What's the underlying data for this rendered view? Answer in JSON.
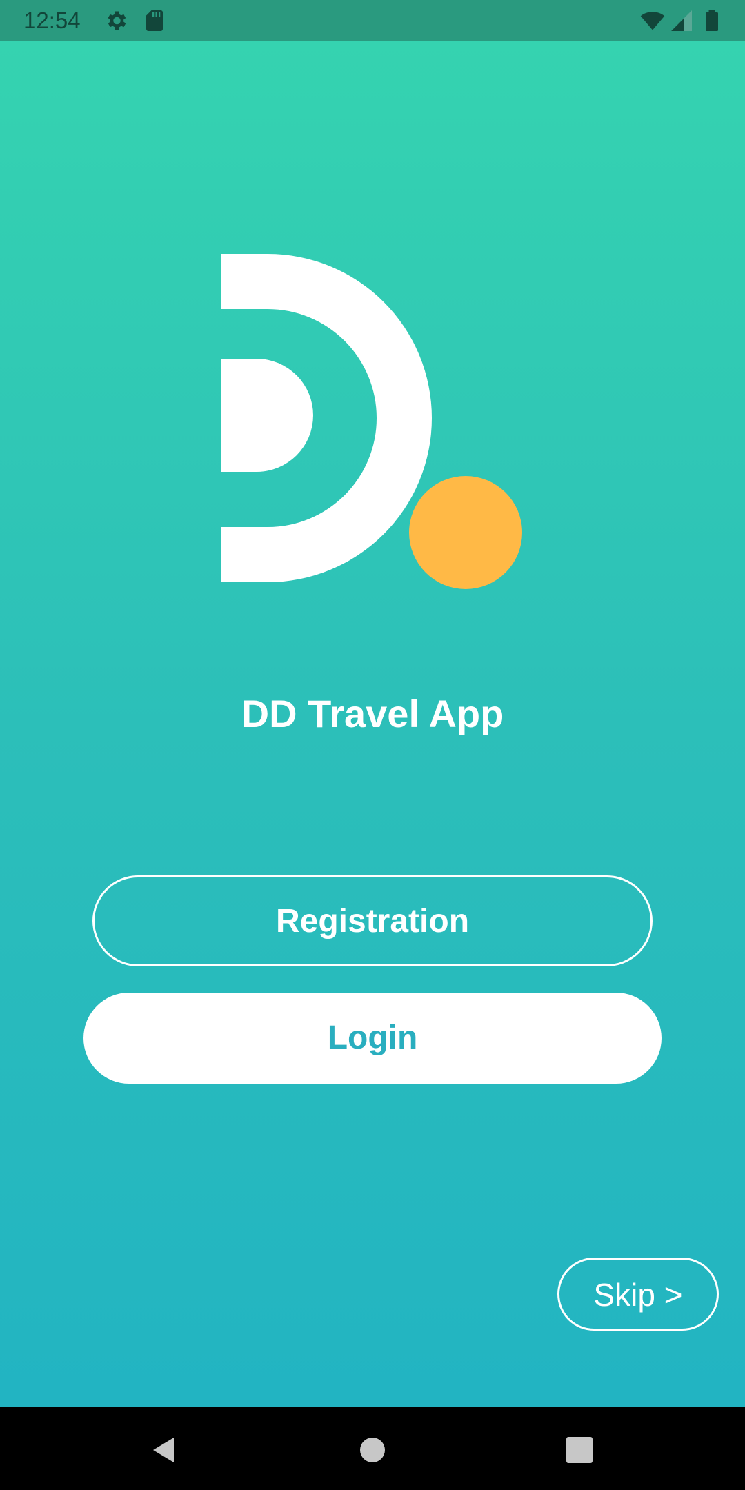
{
  "status_bar": {
    "time": "12:54",
    "icons": [
      "gear-icon",
      "sd-card-icon",
      "wifi-icon",
      "signal-icon",
      "battery-icon"
    ]
  },
  "app": {
    "title": "DD Travel App",
    "colors": {
      "gradient_top": "#35d3b0",
      "gradient_bottom": "#22b4c2",
      "accent_dot": "#ffb946",
      "login_text": "#29aebf"
    }
  },
  "buttons": {
    "registration_label": "Registration",
    "login_label": "Login",
    "skip_label": "Skip >"
  },
  "nav_bar": {
    "icons": [
      "back-icon",
      "home-icon",
      "recents-icon"
    ]
  }
}
